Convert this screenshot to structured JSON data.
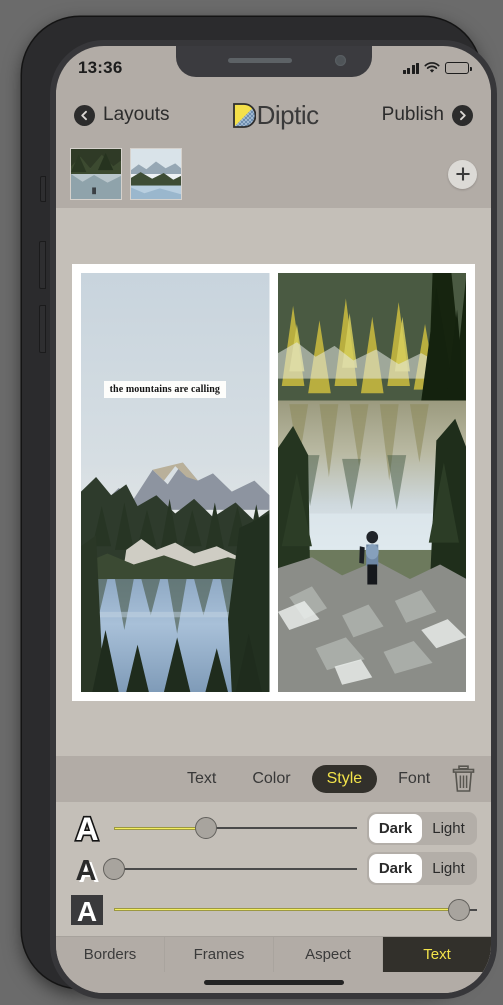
{
  "status_bar": {
    "time": "13:36",
    "cellular_icon": "signal-bars-icon",
    "wifi_icon": "wifi-icon",
    "battery_icon": "battery-icon",
    "battery_level": 70
  },
  "nav_bar": {
    "back_label": "Layouts",
    "back_icon": "chevron-left-circle-icon",
    "app_title": "Diptic",
    "forward_label": "Publish",
    "forward_icon": "chevron-right-circle-icon"
  },
  "filmstrip": {
    "thumbnails": [
      {
        "alt": "lake-forest-photo"
      },
      {
        "alt": "mountain-lake-photo"
      }
    ],
    "add_icon": "plus-icon"
  },
  "canvas": {
    "panes": [
      {
        "alt": "mountain-peaks-above-clouds-lake",
        "text_overlay": "the mountains are calling"
      },
      {
        "alt": "hiker-on-rocky-trail-alpine-lake"
      }
    ]
  },
  "editor_tabs": {
    "items": [
      {
        "label": "Text",
        "active": false
      },
      {
        "label": "Color",
        "active": false
      },
      {
        "label": "Style",
        "active": true
      },
      {
        "label": "Font",
        "active": false
      }
    ],
    "delete_icon": "trash-icon"
  },
  "style_controls": {
    "rows": [
      {
        "icon": "letter-a-outline-icon",
        "slider_value": 38,
        "has_segmented": true,
        "segmented": {
          "options": [
            "Dark",
            "Light"
          ],
          "selected": "Dark"
        }
      },
      {
        "icon": "letter-a-shadow-icon",
        "slider_value": 0,
        "has_segmented": true,
        "segmented": {
          "options": [
            "Dark",
            "Light"
          ],
          "selected": "Dark"
        }
      },
      {
        "icon": "letter-a-background-icon",
        "slider_value": 95,
        "has_segmented": false,
        "segmented": {
          "options": [],
          "selected": ""
        }
      }
    ]
  },
  "bottom_bar": {
    "items": [
      {
        "label": "Borders",
        "active": false
      },
      {
        "label": "Frames",
        "active": false
      },
      {
        "label": "Aspect",
        "active": false
      },
      {
        "label": "Text",
        "active": true
      }
    ]
  },
  "colors": {
    "accent_yellow": "#f2e34a",
    "slider_yellow": "#f4ef61",
    "dark_chrome": "#32302b",
    "chrome_gray": "#b2aca6",
    "canvas_gray": "#c4bfb8"
  }
}
